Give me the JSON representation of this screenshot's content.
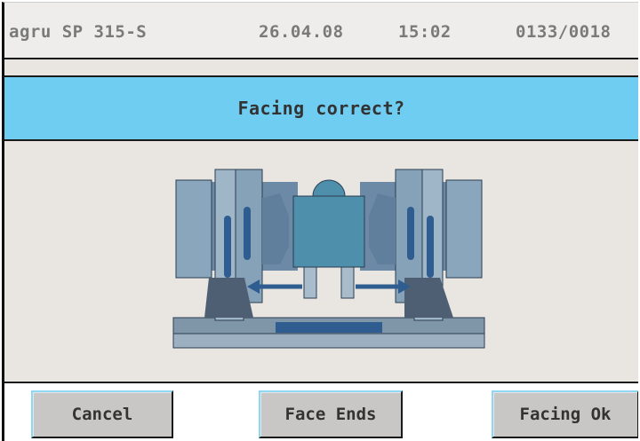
{
  "status_bar": {
    "device": "agru SP 315-S",
    "date": "26.04.08",
    "time": "15:02",
    "counter": "0133/0018"
  },
  "prompt": {
    "title": "Facing correct?"
  },
  "illustration": {
    "icon": "butt-fusion-machine-facing-icon"
  },
  "buttons": {
    "cancel": "Cancel",
    "face_ends": "Face Ends",
    "facing_ok": "Facing Ok"
  },
  "colors": {
    "title_band": "#6fcdf2",
    "button_face": "#c8c7c6",
    "button_highlight": "#8fd6f3",
    "background": "#e9e6e2"
  }
}
